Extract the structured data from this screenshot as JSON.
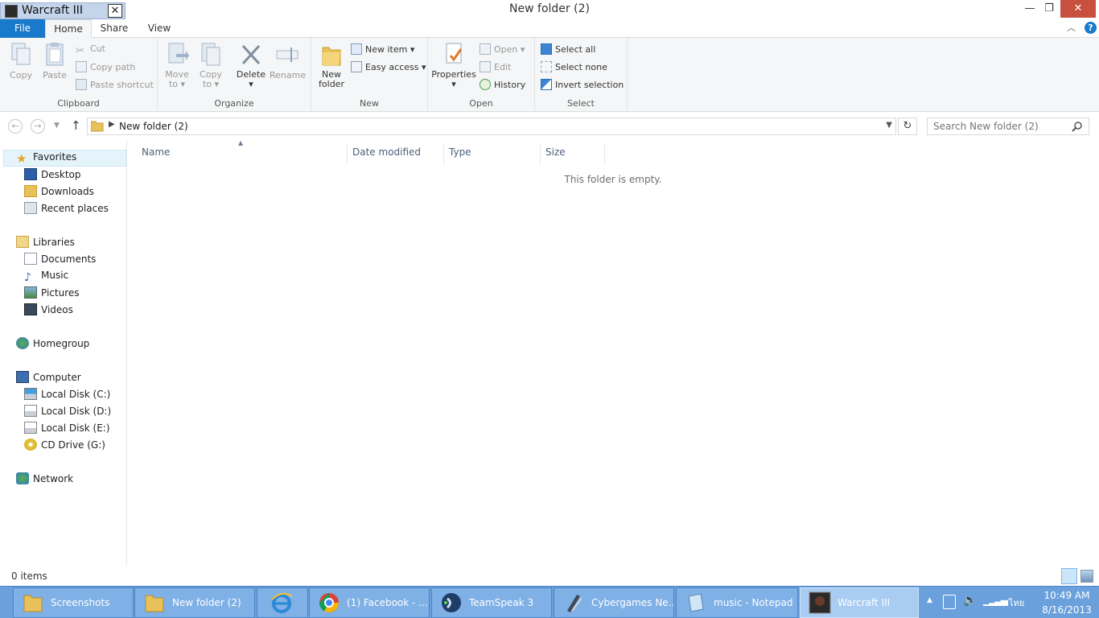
{
  "window": {
    "title": "New folder (2)",
    "overlay_tab_title": "Warcraft III",
    "overlay_tab_close": "✕",
    "minimize": "—",
    "restore": "❐",
    "close": "✕"
  },
  "ribbon_tabs": [
    "File",
    "Home",
    "Share",
    "View"
  ],
  "ribbon": {
    "clipboard": {
      "label": "Clipboard",
      "copy": "Copy",
      "paste": "Paste",
      "cut": "Cut",
      "copy_path": "Copy path",
      "paste_shortcut": "Paste shortcut"
    },
    "organize": {
      "label": "Organize",
      "move_to_1": "Move",
      "move_to_2": "to",
      "copy_to_1": "Copy",
      "copy_to_2": "to",
      "delete": "Delete",
      "rename": "Rename"
    },
    "new": {
      "label": "New",
      "new_folder_1": "New",
      "new_folder_2": "folder",
      "new_item": "New item",
      "easy_access": "Easy access"
    },
    "open": {
      "label": "Open",
      "properties": "Properties",
      "open": "Open",
      "edit": "Edit",
      "history": "History"
    },
    "select": {
      "label": "Select",
      "select_all": "Select all",
      "select_none": "Select none",
      "invert_selection": "Invert selection"
    }
  },
  "address": {
    "path": "New folder (2)",
    "search_placeholder": "Search New folder (2)"
  },
  "nav": {
    "favorites": "Favorites",
    "desktop": "Desktop",
    "downloads": "Downloads",
    "recent_places": "Recent places",
    "libraries": "Libraries",
    "documents": "Documents",
    "music": "Music",
    "pictures": "Pictures",
    "videos": "Videos",
    "homegroup": "Homegroup",
    "computer": "Computer",
    "disk_c": "Local Disk (C:)",
    "disk_d": "Local Disk (D:)",
    "disk_e": "Local Disk (E:)",
    "cd_drive": "CD Drive (G:)",
    "network": "Network"
  },
  "columns": [
    "Name",
    "Date modified",
    "Type",
    "Size"
  ],
  "empty_message": "This folder is empty.",
  "status": {
    "items": "0 items"
  },
  "taskbar": {
    "items": [
      "Screenshots",
      "New folder (2)",
      "",
      "(1) Facebook - ...",
      "TeamSpeak 3",
      "Cybergames Ne...",
      "music - Notepad",
      "Warcraft III"
    ],
    "lang": "ไทย",
    "time": "10:49 AM",
    "date": "8/16/2013"
  },
  "colors": {
    "accent": "#1979ca",
    "taskbar": "#6aa0dc",
    "folder": "#e8c15a"
  }
}
